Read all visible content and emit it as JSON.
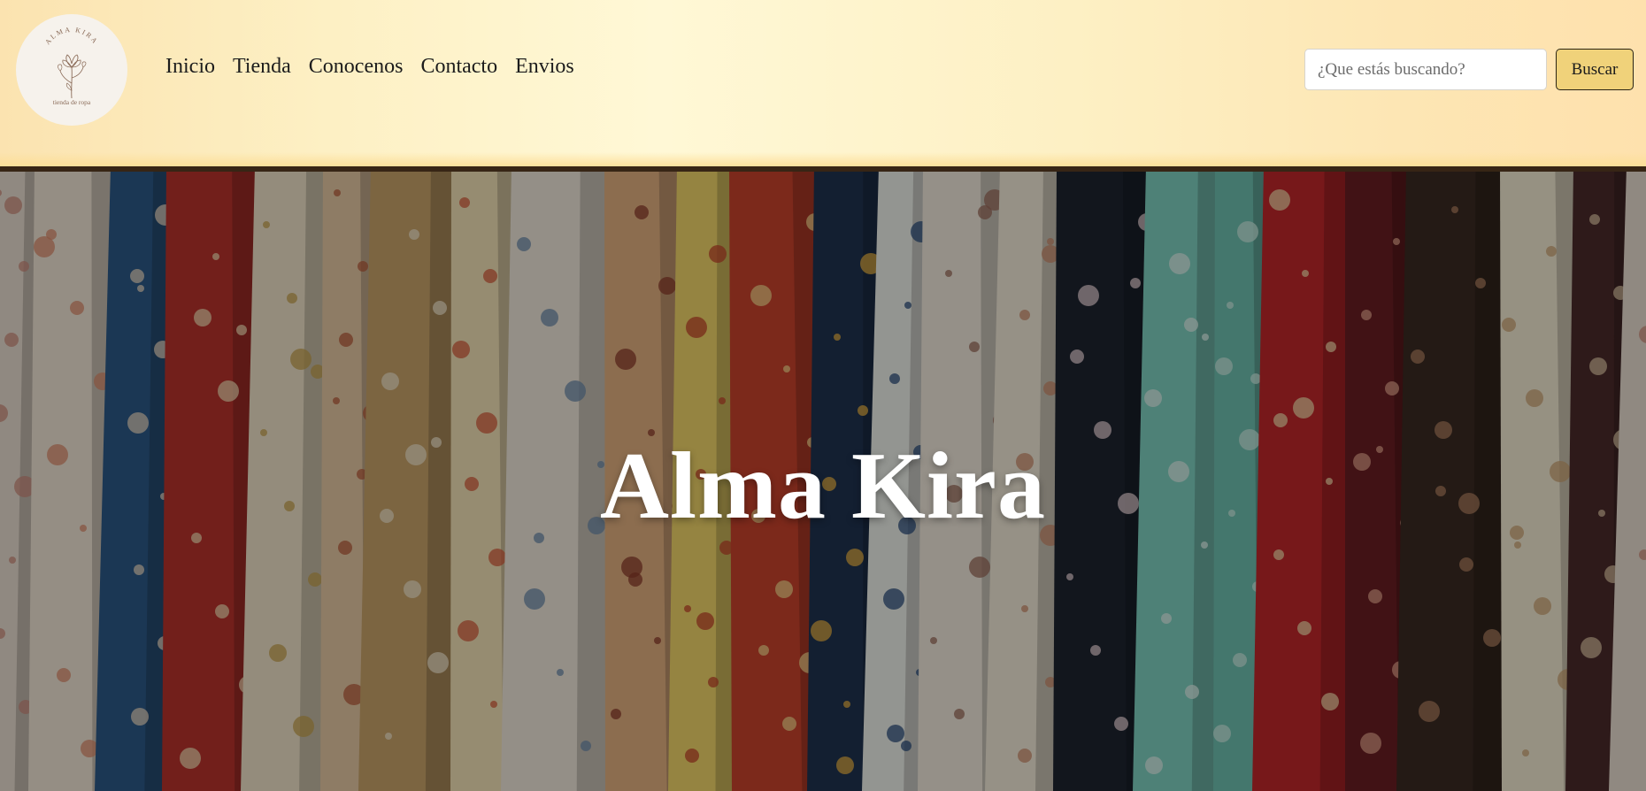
{
  "brand": {
    "logo_top_text": "ALMA KIRA",
    "logo_bottom_text": "tienda de ropa"
  },
  "nav": {
    "links": [
      "Inicio",
      "Tienda",
      "Conocenos",
      "Contacto",
      "Envios"
    ]
  },
  "search": {
    "placeholder": "¿Que estás buscando?",
    "value": "",
    "button_label": "Buscar"
  },
  "hero": {
    "title": "Alma Kira"
  },
  "colors": {
    "navbar_light": "#fff8d6",
    "navbar_warm": "#fde6b4",
    "button_fill": "#f0d27a"
  }
}
